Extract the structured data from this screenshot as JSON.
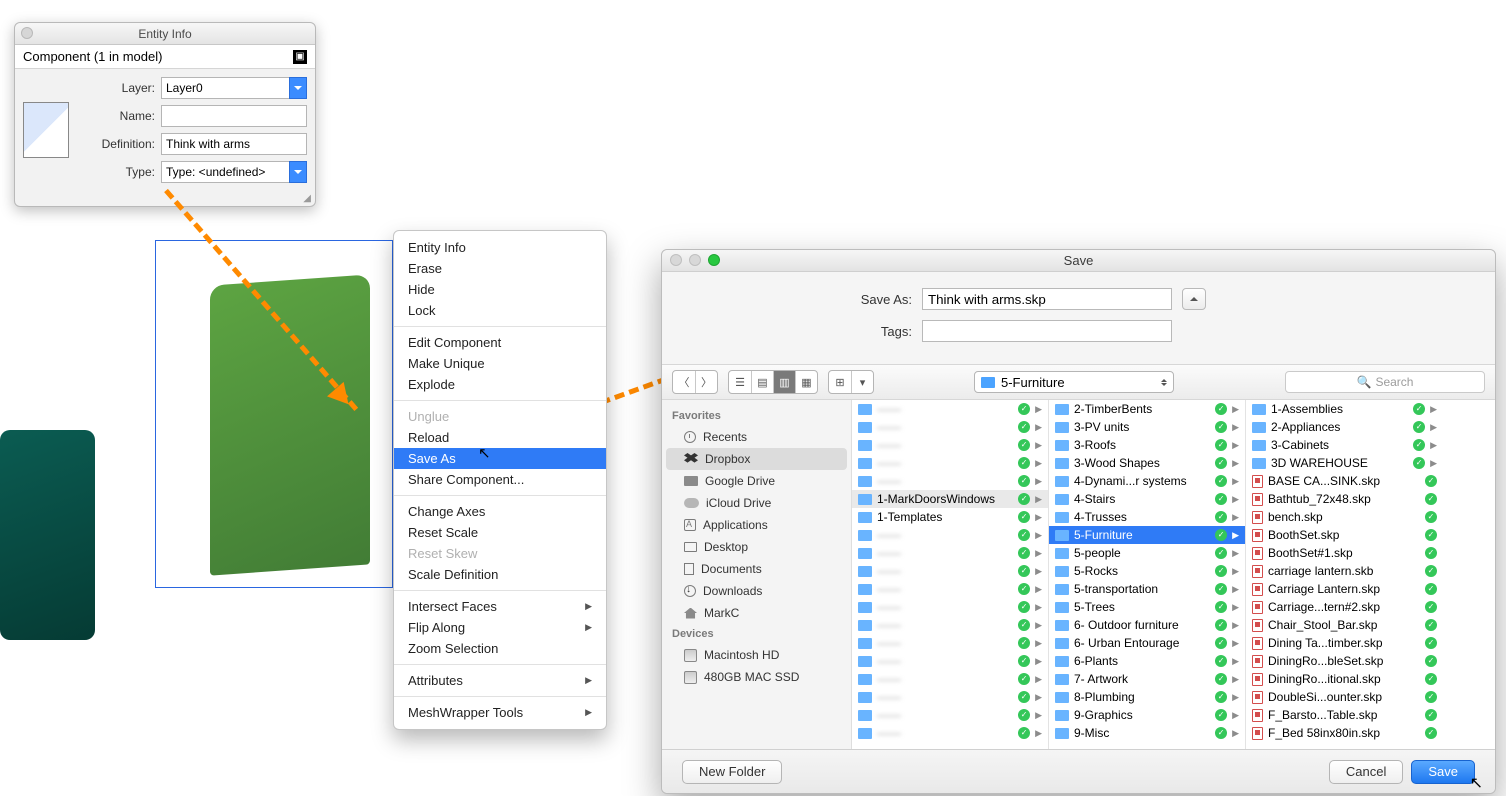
{
  "entity_info": {
    "title": "Entity Info",
    "subtitle": "Component (1 in model)",
    "layer_label": "Layer:",
    "layer_value": "Layer0",
    "name_label": "Name:",
    "name_value": "",
    "definition_label": "Definition:",
    "definition_value": "Think with arms",
    "type_label": "Type:",
    "type_value": "Type: <undefined>"
  },
  "context_menu": {
    "groups": [
      [
        {
          "label": "Entity Info",
          "state": "normal"
        },
        {
          "label": "Erase",
          "state": "normal"
        },
        {
          "label": "Hide",
          "state": "normal"
        },
        {
          "label": "Lock",
          "state": "normal"
        }
      ],
      [
        {
          "label": "Edit Component",
          "state": "normal"
        },
        {
          "label": "Make Unique",
          "state": "normal"
        },
        {
          "label": "Explode",
          "state": "normal"
        }
      ],
      [
        {
          "label": "Unglue",
          "state": "disabled"
        },
        {
          "label": "Reload",
          "state": "normal"
        },
        {
          "label": "Save As",
          "state": "selected"
        },
        {
          "label": "Share Component...",
          "state": "normal"
        }
      ],
      [
        {
          "label": "Change Axes",
          "state": "normal"
        },
        {
          "label": "Reset Scale",
          "state": "normal"
        },
        {
          "label": "Reset Skew",
          "state": "disabled"
        },
        {
          "label": "Scale Definition",
          "state": "normal"
        }
      ],
      [
        {
          "label": "Intersect Faces",
          "state": "normal",
          "submenu": true
        },
        {
          "label": "Flip Along",
          "state": "normal",
          "submenu": true
        },
        {
          "label": "Zoom Selection",
          "state": "normal"
        }
      ],
      [
        {
          "label": "Attributes",
          "state": "normal",
          "submenu": true
        }
      ],
      [
        {
          "label": "MeshWrapper Tools",
          "state": "normal",
          "submenu": true
        }
      ]
    ]
  },
  "save_dialog": {
    "title": "Save",
    "save_as_label": "Save As:",
    "save_as_value": "Think with arms.skp",
    "tags_label": "Tags:",
    "tags_value": "",
    "current_folder": "5-Furniture",
    "search_placeholder": "Search",
    "new_folder_label": "New Folder",
    "cancel_label": "Cancel",
    "save_label": "Save",
    "sidebar": {
      "favorites_header": "Favorites",
      "favorites": [
        {
          "icon": "clock",
          "label": "Recents"
        },
        {
          "icon": "dbx",
          "label": "Dropbox",
          "selected": true
        },
        {
          "icon": "fold",
          "label": "Google Drive"
        },
        {
          "icon": "cloud",
          "label": "iCloud Drive"
        },
        {
          "icon": "app",
          "label": "Applications"
        },
        {
          "icon": "desk",
          "label": "Desktop"
        },
        {
          "icon": "doc",
          "label": "Documents"
        },
        {
          "icon": "dl",
          "label": "Downloads"
        },
        {
          "icon": "home",
          "label": "MarkC"
        }
      ],
      "devices_header": "Devices",
      "devices": [
        {
          "icon": "disk",
          "label": "Macintosh HD"
        },
        {
          "icon": "disk",
          "label": "480GB MAC SSD"
        }
      ]
    },
    "columns": [
      {
        "blurred": true,
        "items": [
          {
            "type": "f",
            "name": "——",
            "check": true,
            "arrow": true
          },
          {
            "type": "f",
            "name": "——",
            "check": true,
            "arrow": true
          },
          {
            "type": "f",
            "name": "——",
            "check": true,
            "arrow": true
          },
          {
            "type": "f",
            "name": "——",
            "check": true,
            "arrow": true
          },
          {
            "type": "f",
            "name": "——",
            "check": true,
            "arrow": true
          }
        ],
        "special": [
          {
            "type": "f",
            "name": "1-MarkDoorsWindows",
            "check": true,
            "arrow": true,
            "dim": true
          },
          {
            "type": "f",
            "name": "1-Templates",
            "check": true,
            "arrow": true
          }
        ],
        "blurred_after": true,
        "after_items": [
          {
            "type": "f",
            "name": "——",
            "check": true,
            "arrow": true
          },
          {
            "type": "f",
            "name": "——",
            "check": true,
            "arrow": true
          },
          {
            "type": "f",
            "name": "——",
            "check": true,
            "arrow": true
          },
          {
            "type": "f",
            "name": "——",
            "check": true,
            "arrow": true
          },
          {
            "type": "f",
            "name": "——",
            "check": true,
            "arrow": true
          },
          {
            "type": "f",
            "name": "——",
            "check": true,
            "arrow": true
          },
          {
            "type": "f",
            "name": "——",
            "check": true,
            "arrow": true
          },
          {
            "type": "f",
            "name": "——",
            "check": true,
            "arrow": true
          },
          {
            "type": "f",
            "name": "——",
            "check": true,
            "arrow": true
          },
          {
            "type": "f",
            "name": "——",
            "check": true,
            "arrow": true
          },
          {
            "type": "f",
            "name": "——",
            "check": true,
            "arrow": true
          },
          {
            "type": "f",
            "name": "——",
            "check": true,
            "arrow": true
          }
        ]
      },
      {
        "items": [
          {
            "type": "f",
            "name": "2-TimberBents",
            "check": true,
            "arrow": true
          },
          {
            "type": "f",
            "name": "3-PV units",
            "check": true,
            "arrow": true
          },
          {
            "type": "f",
            "name": "3-Roofs",
            "check": true,
            "arrow": true
          },
          {
            "type": "f",
            "name": "3-Wood Shapes",
            "check": true,
            "arrow": true
          },
          {
            "type": "f",
            "name": "4-Dynami...r systems",
            "check": true,
            "arrow": true
          },
          {
            "type": "f",
            "name": "4-Stairs",
            "check": true,
            "arrow": true
          },
          {
            "type": "f",
            "name": "4-Trusses",
            "check": true,
            "arrow": true
          },
          {
            "type": "f",
            "name": "5-Furniture",
            "check": true,
            "arrow": true,
            "selected": true
          },
          {
            "type": "f",
            "name": "5-people",
            "check": true,
            "arrow": true
          },
          {
            "type": "f",
            "name": "5-Rocks",
            "check": true,
            "arrow": true
          },
          {
            "type": "f",
            "name": "5-transportation",
            "check": true,
            "arrow": true
          },
          {
            "type": "f",
            "name": "5-Trees",
            "check": true,
            "arrow": true
          },
          {
            "type": "f",
            "name": "6- Outdoor furniture",
            "check": true,
            "arrow": true
          },
          {
            "type": "f",
            "name": "6- Urban Entourage",
            "check": true,
            "arrow": true
          },
          {
            "type": "f",
            "name": "6-Plants",
            "check": true,
            "arrow": true
          },
          {
            "type": "f",
            "name": "7- Artwork",
            "check": true,
            "arrow": true
          },
          {
            "type": "f",
            "name": "8-Plumbing",
            "check": true,
            "arrow": true
          },
          {
            "type": "f",
            "name": "9-Graphics",
            "check": true,
            "arrow": true
          },
          {
            "type": "f",
            "name": "9-Misc",
            "check": true,
            "arrow": true
          }
        ]
      },
      {
        "items": [
          {
            "type": "f",
            "name": "1-Assemblies",
            "check": true,
            "arrow": true
          },
          {
            "type": "f",
            "name": "2-Appliances",
            "check": true,
            "arrow": true
          },
          {
            "type": "f",
            "name": "3-Cabinets",
            "check": true,
            "arrow": true
          },
          {
            "type": "f",
            "name": "3D WAREHOUSE",
            "check": true,
            "arrow": true
          },
          {
            "type": "s",
            "name": "BASE CA...SINK.skp",
            "check": true
          },
          {
            "type": "s",
            "name": "Bathtub_72x48.skp",
            "check": true
          },
          {
            "type": "s",
            "name": "bench.skp",
            "check": true
          },
          {
            "type": "s",
            "name": "BoothSet.skp",
            "check": true
          },
          {
            "type": "s",
            "name": "BoothSet#1.skp",
            "check": true
          },
          {
            "type": "s",
            "name": "carriage lantern.skb",
            "check": true
          },
          {
            "type": "s",
            "name": "Carriage Lantern.skp",
            "check": true
          },
          {
            "type": "s",
            "name": "Carriage...tern#2.skp",
            "check": true
          },
          {
            "type": "s",
            "name": "Chair_Stool_Bar.skp",
            "check": true
          },
          {
            "type": "s",
            "name": "Dining Ta...timber.skp",
            "check": true
          },
          {
            "type": "s",
            "name": "DiningRo...bleSet.skp",
            "check": true
          },
          {
            "type": "s",
            "name": "DiningRo...itional.skp",
            "check": true
          },
          {
            "type": "s",
            "name": "DoubleSi...ounter.skp",
            "check": true
          },
          {
            "type": "s",
            "name": "F_Barsto...Table.skp",
            "check": true
          },
          {
            "type": "s",
            "name": "F_Bed 58inx80in.skp",
            "check": true
          }
        ]
      }
    ]
  }
}
